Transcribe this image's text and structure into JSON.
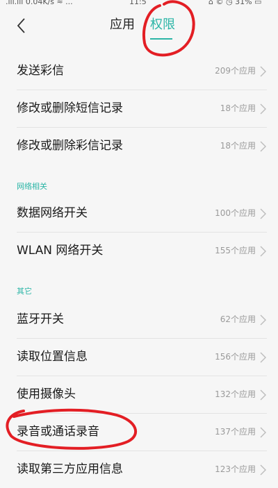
{
  "status_bar": {
    "left": ".ill.ill 0.04K/s ≈ ...",
    "time": "11:5",
    "right": "⌂ © ◷ 31% ▭"
  },
  "header": {
    "tabs": [
      {
        "label": "应用",
        "active": false
      },
      {
        "label": "权限",
        "active": true
      }
    ],
    "back_icon": "back-arrow-icon",
    "accent_color": "#2bb5a6"
  },
  "items": [
    {
      "label": "发送彩信",
      "count": "209个应用"
    },
    {
      "label": "修改或删除短信记录",
      "count": "18个应用"
    },
    {
      "label": "修改或删除彩信记录",
      "count": "18个应用"
    }
  ],
  "sections": [
    {
      "title": "网络相关",
      "items": [
        {
          "label": "数据网络开关",
          "count": "100个应用"
        },
        {
          "label": "WLAN 网络开关",
          "count": "155个应用"
        }
      ]
    },
    {
      "title": "其它",
      "items": [
        {
          "label": "蓝牙开关",
          "count": "62个应用"
        },
        {
          "label": "读取位置信息",
          "count": "156个应用"
        },
        {
          "label": "使用摄像头",
          "count": "132个应用"
        },
        {
          "label": "录音或通话录音",
          "count": "137个应用"
        },
        {
          "label": "读取第三方应用信息",
          "count": "123个应用"
        }
      ]
    }
  ],
  "annotation_color": "#e31e24"
}
